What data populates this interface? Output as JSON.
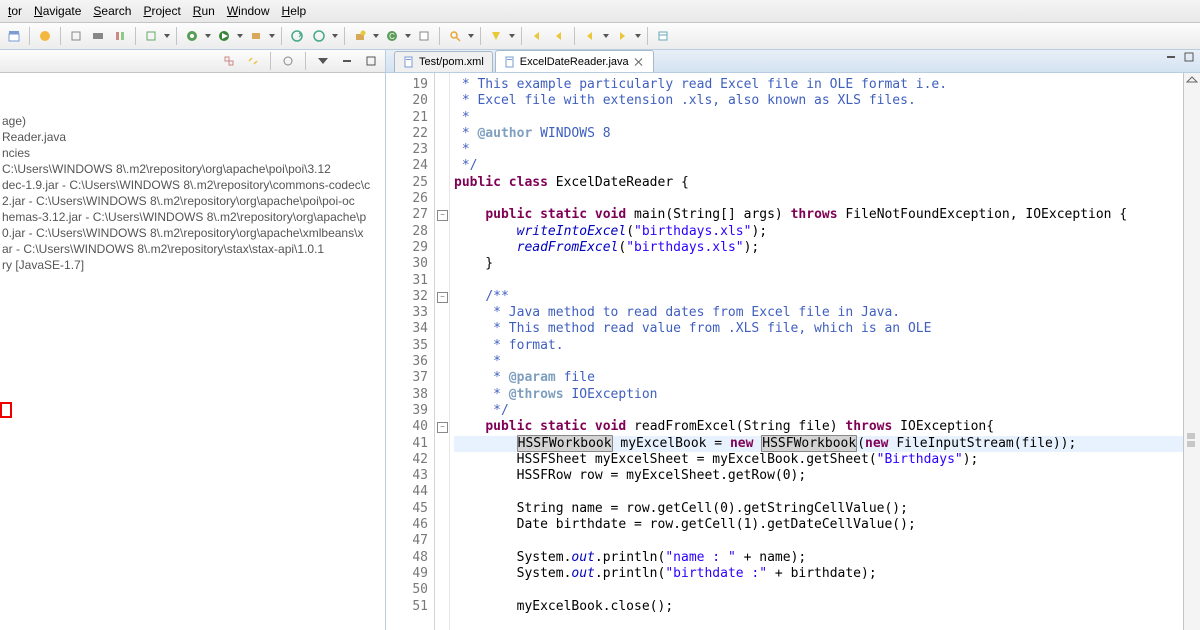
{
  "menu": [
    "tor",
    "Navigate",
    "Search",
    "Project",
    "Run",
    "Window",
    "Help"
  ],
  "tabs": [
    {
      "label": "Test/pom.xml",
      "active": false
    },
    {
      "label": "ExcelDateReader.java",
      "active": true
    }
  ],
  "tree": [
    "age)",
    "Reader.java",
    "ncies",
    "C:\\Users\\WINDOWS 8\\.m2\\repository\\org\\apache\\poi\\poi\\3.12",
    "dec-1.9.jar - C:\\Users\\WINDOWS 8\\.m2\\repository\\commons-codec\\c",
    "2.jar - C:\\Users\\WINDOWS 8\\.m2\\repository\\org\\apache\\poi\\poi-oc",
    "hemas-3.12.jar - C:\\Users\\WINDOWS 8\\.m2\\repository\\org\\apache\\p",
    "0.jar - C:\\Users\\WINDOWS 8\\.m2\\repository\\org\\apache\\xmlbeans\\x",
    "ar - C:\\Users\\WINDOWS 8\\.m2\\repository\\stax\\stax-api\\1.0.1",
    "ry [JavaSE-1.7]"
  ],
  "lines": [
    {
      "n": 19,
      "h": " * <span class=\"cm\">This example particularly read Excel file in OLE format i.e.</span>"
    },
    {
      "n": 20,
      "h": " * <span class=\"cm\">Excel file with extension .xls, also known as XLS files.</span>"
    },
    {
      "n": 21,
      "h": " *"
    },
    {
      "n": 22,
      "h": " * <span class=\"ct\">@author</span> <span class=\"cm\">WINDOWS 8</span>"
    },
    {
      "n": 23,
      "h": " *"
    },
    {
      "n": 24,
      "h": " */"
    },
    {
      "n": 25,
      "h": "<span class=\"kw\">public</span> <span class=\"kw\">class</span> ExcelDateReader {"
    },
    {
      "n": 26,
      "h": ""
    },
    {
      "n": 27,
      "h": "    <span class=\"kw\">public</span> <span class=\"kw\">static</span> <span class=\"kw\">void</span> main(String[] args) <span class=\"kw\">throws</span> FileNotFoundException, IOException {",
      "fold": "-"
    },
    {
      "n": 28,
      "h": "        <span class=\"em\">writeIntoExcel</span>(<span class=\"st\">\"birthdays.xls\"</span>);"
    },
    {
      "n": 29,
      "h": "        <span class=\"em\">readFromExcel</span>(<span class=\"st\">\"birthdays.xls\"</span>);"
    },
    {
      "n": 30,
      "h": "    }"
    },
    {
      "n": 31,
      "h": ""
    },
    {
      "n": 32,
      "h": "    <span class=\"cm\">/**</span>",
      "fold": "-"
    },
    {
      "n": 33,
      "h": "<span class=\"cm\">     * Java method to read dates from Excel file in Java.</span>"
    },
    {
      "n": 34,
      "h": "<span class=\"cm\">     * This method read value from .XLS file, which is an OLE</span>"
    },
    {
      "n": 35,
      "h": "<span class=\"cm\">     * format.</span>"
    },
    {
      "n": 36,
      "h": "<span class=\"cm\">     *</span>"
    },
    {
      "n": 37,
      "h": "<span class=\"cm\">     * </span><span class=\"ct\">@param</span><span class=\"cm\"> file</span>"
    },
    {
      "n": 38,
      "h": "<span class=\"cm\">     * </span><span class=\"ct\">@throws</span><span class=\"cm\"> IOException</span>"
    },
    {
      "n": 39,
      "h": "<span class=\"cm\">     */</span>"
    },
    {
      "n": 40,
      "h": "    <span class=\"kw\">public</span> <span class=\"kw\">static</span> <span class=\"kw\">void</span> readFromExcel(String file) <span class=\"kw\">throws</span> IOException{",
      "fold": "-"
    },
    {
      "n": 41,
      "h": "        <span class=\"occ\">HSSFWorkbook</span> myExcelBook = <span class=\"kw\">new</span> <span class=\"occ\">HSSFWorkbook</span>(<span class=\"kw\">new</span> FileInputStream(file));",
      "hl": true
    },
    {
      "n": 42,
      "h": "        HSSFSheet myExcelSheet = myExcelBook.getSheet(<span class=\"st\">\"Birthdays\"</span>);"
    },
    {
      "n": 43,
      "h": "        HSSFRow row = myExcelSheet.getRow(0);"
    },
    {
      "n": 44,
      "h": ""
    },
    {
      "n": 45,
      "h": "        String name = row.getCell(0).getStringCellValue();"
    },
    {
      "n": 46,
      "h": "        Date birthdate = row.getCell(1).getDateCellValue();"
    },
    {
      "n": 47,
      "h": ""
    },
    {
      "n": 48,
      "h": "        System.<span class=\"fi\">out</span>.println(<span class=\"st\">\"name : \"</span> + name);"
    },
    {
      "n": 49,
      "h": "        System.<span class=\"fi\">out</span>.println(<span class=\"st\">\"birthdate :\"</span> + birthdate);"
    },
    {
      "n": 50,
      "h": ""
    },
    {
      "n": 51,
      "h": "        myExcelBook.close();"
    }
  ]
}
